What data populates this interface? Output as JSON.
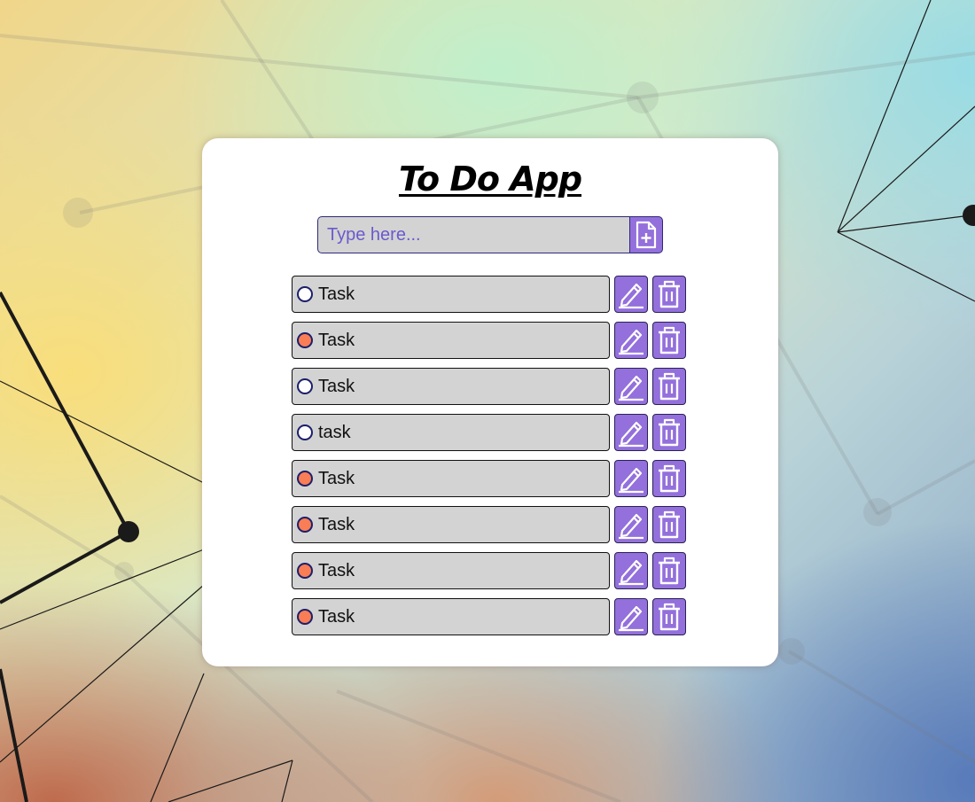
{
  "app": {
    "title": "To Do App"
  },
  "new_task": {
    "placeholder": "Type here...",
    "value": "",
    "add_icon": "file-plus-icon"
  },
  "tasks": [
    {
      "text": "Task",
      "status": "pending"
    },
    {
      "text": "Task",
      "status": "completed"
    },
    {
      "text": "Task",
      "status": "pending"
    },
    {
      "text": "task",
      "status": "pending"
    },
    {
      "text": "Task",
      "status": "completed"
    },
    {
      "text": "Task",
      "status": "completed"
    },
    {
      "text": "Task",
      "status": "completed"
    },
    {
      "text": "Task",
      "status": "completed"
    }
  ],
  "task_actions": {
    "edit_icon": "pencil-icon",
    "delete_icon": "trash-icon"
  },
  "colors": {
    "accent": "#9370db",
    "field_background": "#d3d3d3",
    "completed_dot": "#f97d55",
    "pending_dot": "#ffffff",
    "dot_border": "#1c1f6b"
  }
}
